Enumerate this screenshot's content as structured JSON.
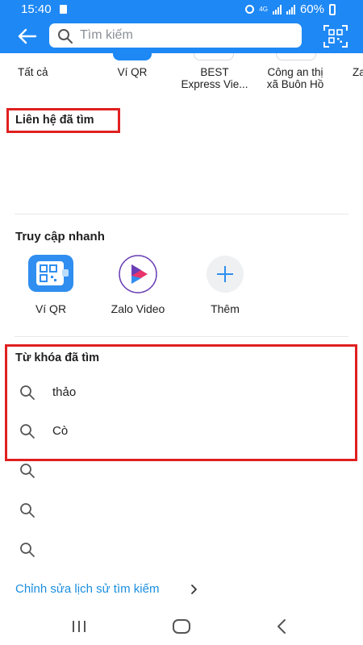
{
  "status": {
    "time": "15:40",
    "network": "4G",
    "battery": "60%"
  },
  "search": {
    "placeholder": "Tìm kiếm"
  },
  "tabs": [
    {
      "label": "Tất cả"
    },
    {
      "label": "Ví QR"
    },
    {
      "label": "BEST\nExpress Vie..."
    },
    {
      "label": "Công an thị\nxã Buôn Hồ"
    },
    {
      "label": "Za"
    }
  ],
  "contacts": {
    "title": "Liên hệ đã tìm"
  },
  "quick_access": {
    "title": "Truy cập nhanh",
    "items": [
      {
        "label": "Ví QR",
        "icon": "qr-wallet-icon"
      },
      {
        "label": "Zalo Video",
        "icon": "zalo-video-icon"
      },
      {
        "label": "Thêm",
        "icon": "plus-icon"
      }
    ]
  },
  "keywords": {
    "title": "Từ khóa đã tìm",
    "items": [
      "thảo",
      "Cò",
      "",
      "",
      ""
    ]
  },
  "edit_history": {
    "label": "Chỉnh sửa lịch sử tìm kiếm"
  },
  "colors": {
    "header": "#1e88f5",
    "accent": "#1a8ee0",
    "highlight": "#e02020"
  }
}
